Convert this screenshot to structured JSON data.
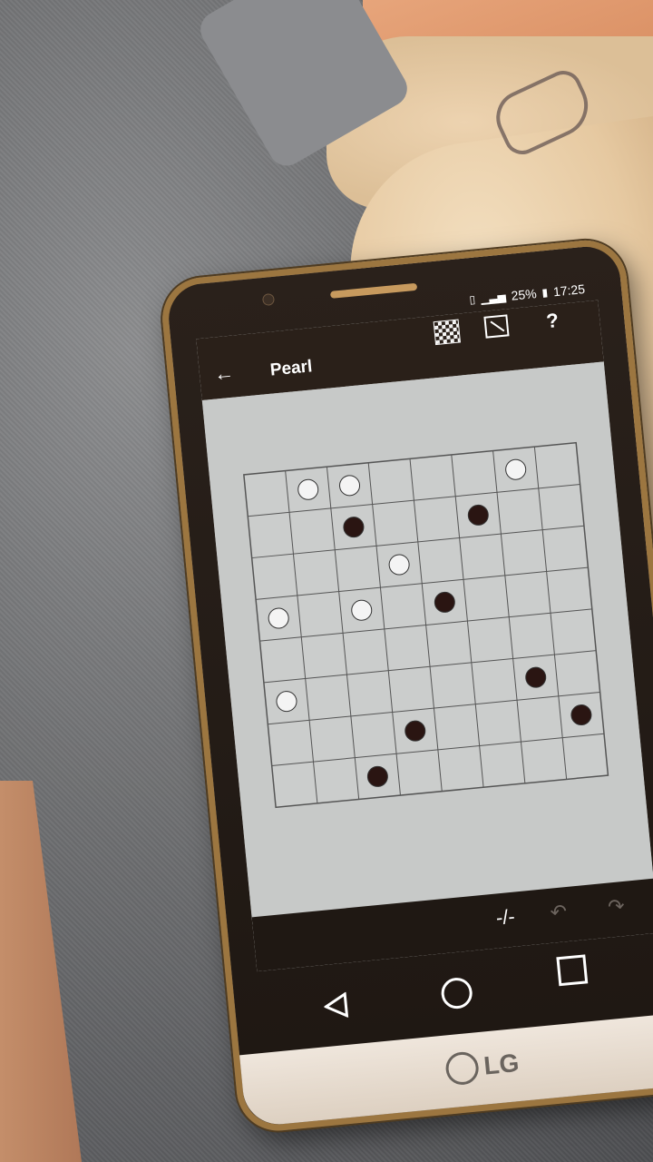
{
  "status_bar": {
    "battery": "25%",
    "time": "17:25"
  },
  "app": {
    "title": "Pearl"
  },
  "board": {
    "rows": 8,
    "cols": 8,
    "white_pearls": [
      [
        0,
        1
      ],
      [
        0,
        2
      ],
      [
        0,
        6
      ],
      [
        2,
        3
      ],
      [
        3,
        0
      ],
      [
        3,
        2
      ],
      [
        5,
        0
      ]
    ],
    "black_pearls": [
      [
        1,
        2
      ],
      [
        1,
        5
      ],
      [
        3,
        4
      ],
      [
        5,
        6
      ],
      [
        6,
        3
      ],
      [
        6,
        7
      ],
      [
        7,
        2
      ]
    ]
  },
  "colors": {
    "toolbar": "#2a2019",
    "screen_bg": "#c7c9c8",
    "grid_line": "#555555",
    "white_pearl": "#f4f4f4",
    "black_pearl": "#2a1512"
  },
  "icons": {
    "back": "arrow-left-icon",
    "checker": "checkerboard-icon",
    "resize": "resize-icon",
    "help": "help-icon",
    "pencil": "line-tool-icon",
    "undo": "undo-icon",
    "redo": "redo-icon"
  },
  "brand": "LG"
}
